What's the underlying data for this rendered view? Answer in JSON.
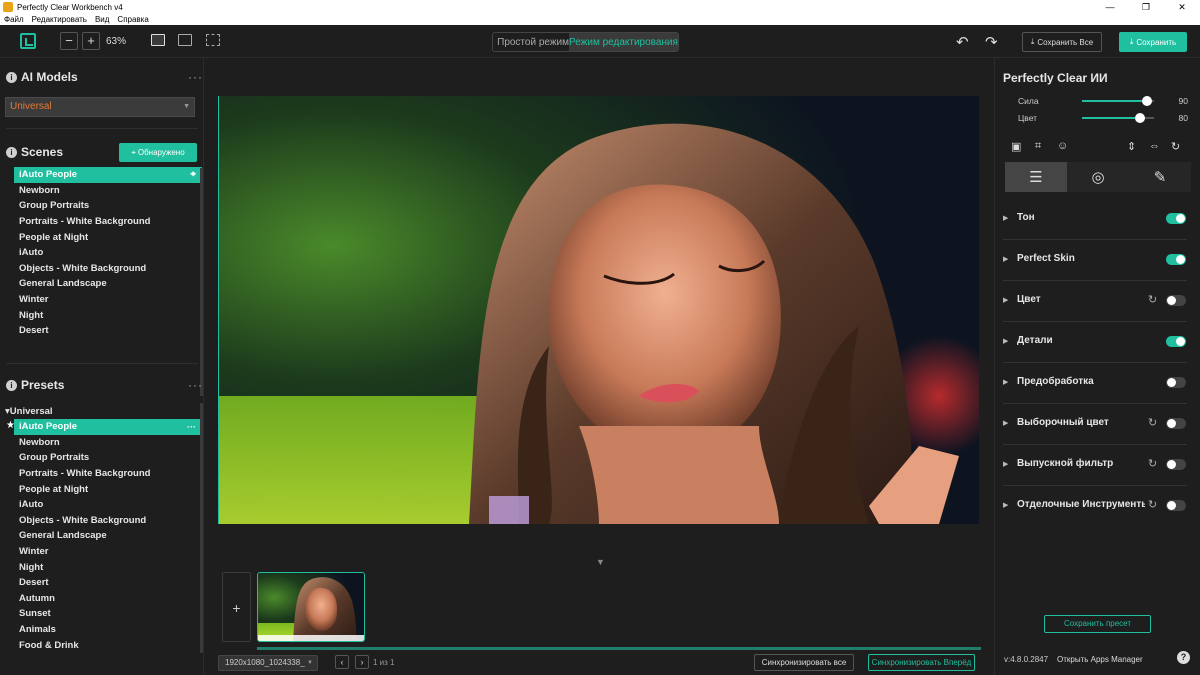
{
  "window": {
    "title": "Perfectly Clear Workbench v4",
    "controls": [
      "—",
      "❐",
      "✕"
    ]
  },
  "menu": [
    "Файл",
    "Редактировать",
    "Вид",
    "Справка"
  ],
  "toolbar": {
    "zoom_out": "−",
    "zoom_in": "+",
    "zoom_level": "63%",
    "mode_simple": "Простой режим",
    "mode_edit": "Режим редактирования",
    "save_all": "Сохранить Все",
    "save": "Сохранить"
  },
  "left": {
    "ai_models_title": "AI Models",
    "model_selected": "Universal",
    "scenes_title": "Scenes",
    "detected_label": "Обнаружено",
    "scenes": [
      "iAuto People",
      "Newborn",
      "Group Portraits",
      "Portraits - White Background",
      "People at Night",
      "iAuto",
      "Objects - White Background",
      "General Landscape",
      "Winter",
      "Night",
      "Desert"
    ],
    "presets_title": "Presets",
    "presets_root": "Universal",
    "presets": [
      "iAuto People",
      "Newborn",
      "Group Portraits",
      "Portraits - White Background",
      "People at Night",
      "iAuto",
      "Objects - White Background",
      "General Landscape",
      "Winter",
      "Night",
      "Desert",
      "Autumn",
      "Sunset",
      "Animals",
      "Food & Drink"
    ]
  },
  "canvas": {
    "add": "+",
    "file_info": "1920x1080_1024338_",
    "page_info": "1 из 1",
    "sync_all": "Синхронизировать все",
    "sync_forward": "Синхронизировать Вперёд"
  },
  "right": {
    "title": "Perfectly Clear ИИ",
    "sliders": [
      {
        "label": "Сила",
        "value": "90",
        "level": 0.9
      },
      {
        "label": "Цвет",
        "value": "80",
        "level": 0.8
      }
    ],
    "sections": [
      {
        "label": "Тон",
        "on": true,
        "reset": false
      },
      {
        "label": "Perfect Skin",
        "on": true,
        "reset": false
      },
      {
        "label": "Цвет",
        "on": false,
        "reset": true
      },
      {
        "label": "Детали",
        "on": true,
        "reset": false
      },
      {
        "label": "Предобработка",
        "on": false,
        "reset": false
      },
      {
        "label": "Выборочный цвет",
        "on": false,
        "reset": true
      },
      {
        "label": "Выпускной фильтр",
        "on": false,
        "reset": true
      },
      {
        "label": "Отделочные Инструменты",
        "on": false,
        "reset": true
      }
    ],
    "save_preset": "Сохранить пресет",
    "version": "v:4.8.0.2847",
    "apps_manager": "Открыть Apps Manager",
    "help": "?"
  },
  "colors": {
    "accent": "#1fbf9f",
    "bg": "#1e1e1e",
    "model_text": "#e07a3a"
  }
}
